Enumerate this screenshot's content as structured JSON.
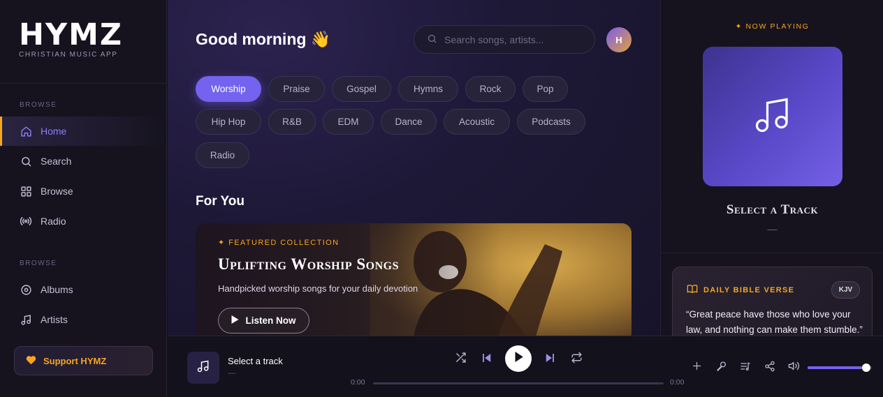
{
  "brand": {
    "title": "HYMZ",
    "subtitle": "CHRISTIAN MUSIC APP"
  },
  "sidebar": {
    "section1_label": "BROWSE",
    "section2_label": "BROWSE",
    "items": [
      {
        "label": "Home",
        "icon": "home-icon",
        "active": true
      },
      {
        "label": "Search",
        "icon": "search-icon"
      },
      {
        "label": "Browse",
        "icon": "grid-icon"
      },
      {
        "label": "Radio",
        "icon": "radio-icon"
      },
      {
        "label": "Albums",
        "icon": "album-icon"
      },
      {
        "label": "Artists",
        "icon": "music-note-icon"
      }
    ],
    "support_label": "Support HYMZ"
  },
  "main": {
    "greeting": "Good morning 👋",
    "search_placeholder": "Search songs, artists...",
    "avatar_initial": "H",
    "genres": [
      "Worship",
      "Praise",
      "Gospel",
      "Hymns",
      "Rock",
      "Pop",
      "Hip Hop",
      "R&B",
      "EDM",
      "Dance",
      "Acoustic",
      "Podcasts",
      "Radio"
    ],
    "active_genre": "Worship",
    "section_title": "For You",
    "hero": {
      "eyebrow": "✦ FEATURED COLLECTION",
      "title": "Uplifting Worship Songs",
      "subtitle": "Handpicked worship songs for your daily devotion",
      "button": "Listen Now"
    }
  },
  "now_playing": {
    "label": "✦ NOW PLAYING",
    "title": "Select a Track",
    "dash": "—"
  },
  "verse": {
    "heading": "DAILY BIBLE VERSE",
    "version": "KJV",
    "text": "“Great peace have those who love your law, and nothing can make them stumble.”"
  },
  "player": {
    "title": "Select a track",
    "subtitle": "—",
    "time_current": "0:00",
    "time_total": "0:00",
    "progress": 0,
    "volume": 0.85
  },
  "colors": {
    "accent": "#7463ee",
    "gold": "#f5a623",
    "bg": "#13111f"
  }
}
